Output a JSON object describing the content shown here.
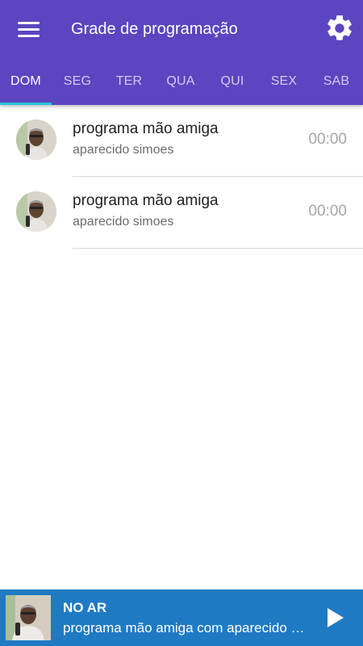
{
  "toolbar": {
    "title": "Grade de programação",
    "menu_icon": "hamburger-menu-icon",
    "settings_icon": "gear-icon"
  },
  "tabs": [
    {
      "label": "DOM",
      "active": true
    },
    {
      "label": "SEG",
      "active": false
    },
    {
      "label": "TER",
      "active": false
    },
    {
      "label": "QUA",
      "active": false
    },
    {
      "label": "QUI",
      "active": false
    },
    {
      "label": "SEX",
      "active": false
    },
    {
      "label": "SAB",
      "active": false
    }
  ],
  "schedule": [
    {
      "title": "programa mão amiga",
      "host": "aparecido simoes",
      "time": "00:00"
    },
    {
      "title": "programa mão amiga",
      "host": "aparecido simoes",
      "time": "00:00"
    }
  ],
  "player": {
    "label": "NO AR",
    "description": "programa mão amiga com aparecido simoes",
    "play_icon": "play-icon"
  },
  "colors": {
    "app_bar": "#5b45c0",
    "tab_indicator": "#26c6da",
    "player_bar": "#1f7ac4"
  }
}
